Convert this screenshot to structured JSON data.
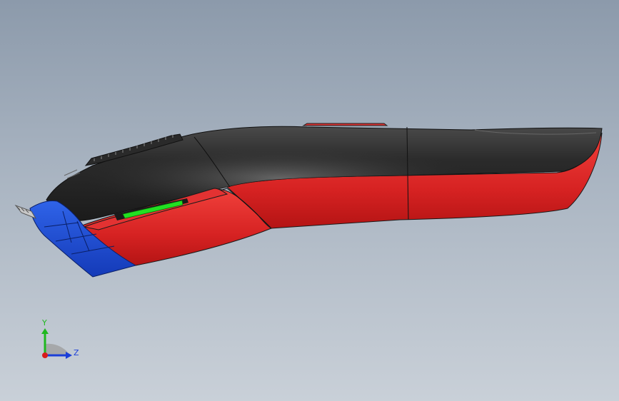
{
  "viewport": {
    "colors": {
      "background_top": "#8c9aab",
      "background_bottom": "#c9d0d8",
      "body_red": "#e52b2b",
      "body_black": "#2a2a2a",
      "head_blue": "#1f4fd6",
      "indicator_green": "#22dd22"
    }
  },
  "triad": {
    "y_label": "Y",
    "z_label": "Z",
    "colors": {
      "y": "#1fb81f",
      "z": "#1b3fd8",
      "x": "#d81b1b"
    }
  }
}
